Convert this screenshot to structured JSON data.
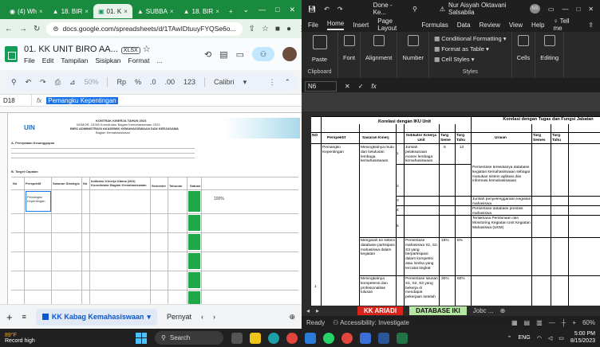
{
  "chrome": {
    "tabs": [
      {
        "label": "(4) Wh",
        "icon": "whatsapp-icon"
      },
      {
        "label": "18. BIR",
        "icon": "drive-icon"
      },
      {
        "label": "01. K",
        "icon": "sheets-icon"
      },
      {
        "label": "SUBBA",
        "icon": "drive-icon"
      },
      {
        "label": "18. BIR",
        "icon": "drive-icon"
      }
    ],
    "new_tab": "+",
    "url": "docs.google.com/spreadsheets/d/1TAwIDtuuyFYQSe6o..."
  },
  "sheets": {
    "title": "01. KK UNIT BIRO AA...",
    "badge": "XLSX",
    "menu": [
      "File",
      "Edit",
      "Tampilan",
      "Sisipkan",
      "Format",
      "..."
    ],
    "toolbar": {
      "zoom": "50%",
      "currency": "Rp",
      "percent": "%",
      "dec_minus": ".0",
      "dec_plus": ".00",
      "number_fmt": "123",
      "font": "Calibri"
    },
    "cell_ref": "D18",
    "formula_value": "Pemangku Kepentingan",
    "sheet_tab_active": "KK Kabag Kemahasiswaan",
    "sheet_tab_next": "Pernyat",
    "preview": {
      "header1": "KONTRAK KINERJA TAHUN 2023",
      "header2": "NOMOR: 18786 Koordinator Bagian Kemahasiswaan 2023",
      "header3": "BIRO ADMINISTRASI AKADEMIK KEMAHASISWAAN DAN KERJASAMA",
      "header4": "Bagian Kemahasiswaan",
      "logo_text": "UIN",
      "section_a": "A.  Pernyataan Kesanggupan",
      "section_b": "B.  Target Capaian",
      "col_headers": [
        "No",
        "Perspektif",
        "Sasaran Strategis",
        "No",
        "Indikator Kinerja Utama (IKU) Koordinator Bagian Kemahasiswaan",
        "Semester",
        "Tahunan",
        "Satuan"
      ],
      "row1_perspektif": "Pemangku Kepentingan",
      "row1_value": "100%"
    }
  },
  "excel": {
    "title": "Done - Ke...",
    "user": "Nur Aisyah Oktavani Salsabila",
    "initials": "NS",
    "tabs": [
      "File",
      "Home",
      "Insert",
      "Page Layout",
      "Formulas",
      "Data",
      "Review",
      "View",
      "Help",
      "Tell me"
    ],
    "ribbon": {
      "paste": "Paste",
      "font": "Font",
      "alignment": "Alignment",
      "number": "Number",
      "cond_format": "Conditional Formatting",
      "format_table": "Format as Table",
      "cell_styles": "Cell Styles",
      "styles_label": "Styles",
      "cells": "Cells",
      "editing": "Editing",
      "clipboard": "Clipboard"
    },
    "name_box": "N6",
    "grid": {
      "title_left": "Korelasi dengan IKU Unit",
      "title_right": "Korelasi dengan Tugas dan Fungsi Jabatan",
      "no": "NO",
      "perspektif": "Perspektif",
      "sasaran": "Sasaran Kinerj",
      "indikator": "Indikator Kinerja Unit",
      "target_sem": "Targ Seme",
      "target_tahun": "Targ Tahu",
      "uraian": "Uraian",
      "target_sem2": "Targ Semes",
      "target_tahun2": "Targ Tahu",
      "row_perspektif": "Pemangku Kepentingan",
      "sasaran1": "Meningkatnya mutu dan kelulusan lembaga kemahasiswaan",
      "indikator1": "Jumlah pelaksanaan monev lembaga kemahasiswaan",
      "t1_sem": "6",
      "t1_tahun": "12",
      "uraian1": "Persentase tersedianya database kegiatan kemahasiswaan sebagai masukan sistem aplikasi dan informasi kemahasiswaan",
      "uraian2": "Jumlah penyelenggaraan kegiatan mahasiswa",
      "uraian3": "Persentase database prestasi mahasiswa",
      "uraian4": "Terlaksana Pembinaan dan Monitoring Kegiatan Unit Kegiatan Mahasiswa (UKM)",
      "sasaran2": "Mengarah ke sistem database partisipasi mahasiswa dalam kegiatan",
      "indikator2": "Persentase mahasiswa S1, S2, S3 yang berpartisipasi dalam kompetisi atau lomba yang tercatat tingkat",
      "t2_sem": "15%",
      "t2_tahun": "5%",
      "sasaran3": "Meningkatnya kompetensi dan profesionalitas lulusan",
      "indikator3": "Persentase lulusan S1, S2, S3 yang bekerja di mendapat pekerjaan setelah",
      "t3_sem": "30%",
      "t3_tahun": "60%",
      "row_nums": [
        "1",
        "2",
        "3",
        "4",
        "5",
        "1"
      ]
    },
    "sheet_tabs": [
      "KK ARIADI",
      "DATABASE IKI",
      "Jobc ..."
    ],
    "status_ready": "Ready",
    "accessibility": "Accessibility: Investigate",
    "zoom": "60%"
  },
  "taskbar": {
    "temp": "89°F",
    "weather": "Record high",
    "search": "Search",
    "lang": "ENG",
    "time": "5:00 PM",
    "date": "8/15/2023"
  }
}
